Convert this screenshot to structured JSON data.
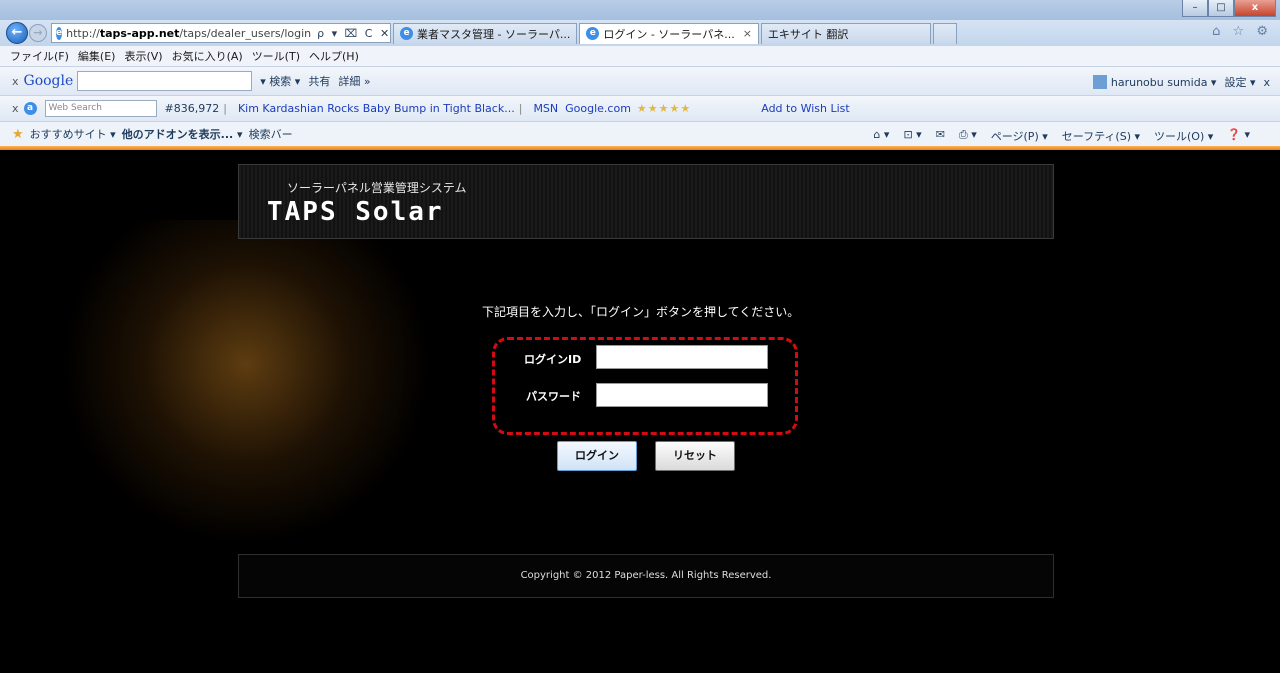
{
  "window": {
    "minimize": "–",
    "maximize": "□",
    "close": "x"
  },
  "nav": {
    "back": "←",
    "forward": "→",
    "url_prefix": "http://",
    "url_host": "taps-app.net",
    "url_path": "/taps/dealer_users/login",
    "addr_tools": "ρ ▾ ⌧ C ✕"
  },
  "tabs": [
    {
      "label": "業者マスタ管理 - ソーラーパ...",
      "active": false
    },
    {
      "label": "ログイン - ソーラーパネ...",
      "active": true,
      "close": "×"
    },
    {
      "label": "エキサイト 翻訳",
      "active": false
    }
  ],
  "browser_icons": "⌂ ☆ ⚙",
  "menu": [
    "ファイル(F)",
    "編集(E)",
    "表示(V)",
    "お気に入り(A)",
    "ツール(T)",
    "ヘルプ(H)"
  ],
  "google_bar": {
    "close": "x",
    "logo": "Google",
    "search_btn": "▾ 検索 ▾",
    "share": "共有",
    "details": "詳細 »",
    "user": "harunobu sumida ▾",
    "settings": "設定 ▾",
    "close_right": "x"
  },
  "toolbar2": {
    "close": "x",
    "web_search": "Web Search",
    "count": "#836,972",
    "link_kim": "Kim Kardashian Rocks Baby Bump in Tight Black...",
    "link_msn": "MSN",
    "link_google": "Google.com",
    "stars": "★★★★★",
    "wishlist": "Add to Wish List"
  },
  "favorites": {
    "item1": "おすすめサイト ▾",
    "item2": "他のアドオンを表示... ▾",
    "item3": "検索バー"
  },
  "commandbar": [
    "⌂ ▾",
    "⊡ ▾",
    "✉",
    "⎙ ▾",
    "ページ(P) ▾",
    "セーフティ(S) ▾",
    "ツール(O) ▾",
    "❓ ▾"
  ],
  "page": {
    "subtitle": "ソーラーパネル営業管理システム",
    "logo": "TAPS Solar",
    "instruction": "下記項目を入力し、「ログイン」ボタンを押してください。",
    "login_id_label": "ログインID",
    "password_label": "パスワード",
    "login_id_value": "",
    "password_value": "",
    "login_button": "ログイン",
    "reset_button": "リセット",
    "copyright": "Copyright © 2012 Paper-less. All Rights Reserved."
  }
}
